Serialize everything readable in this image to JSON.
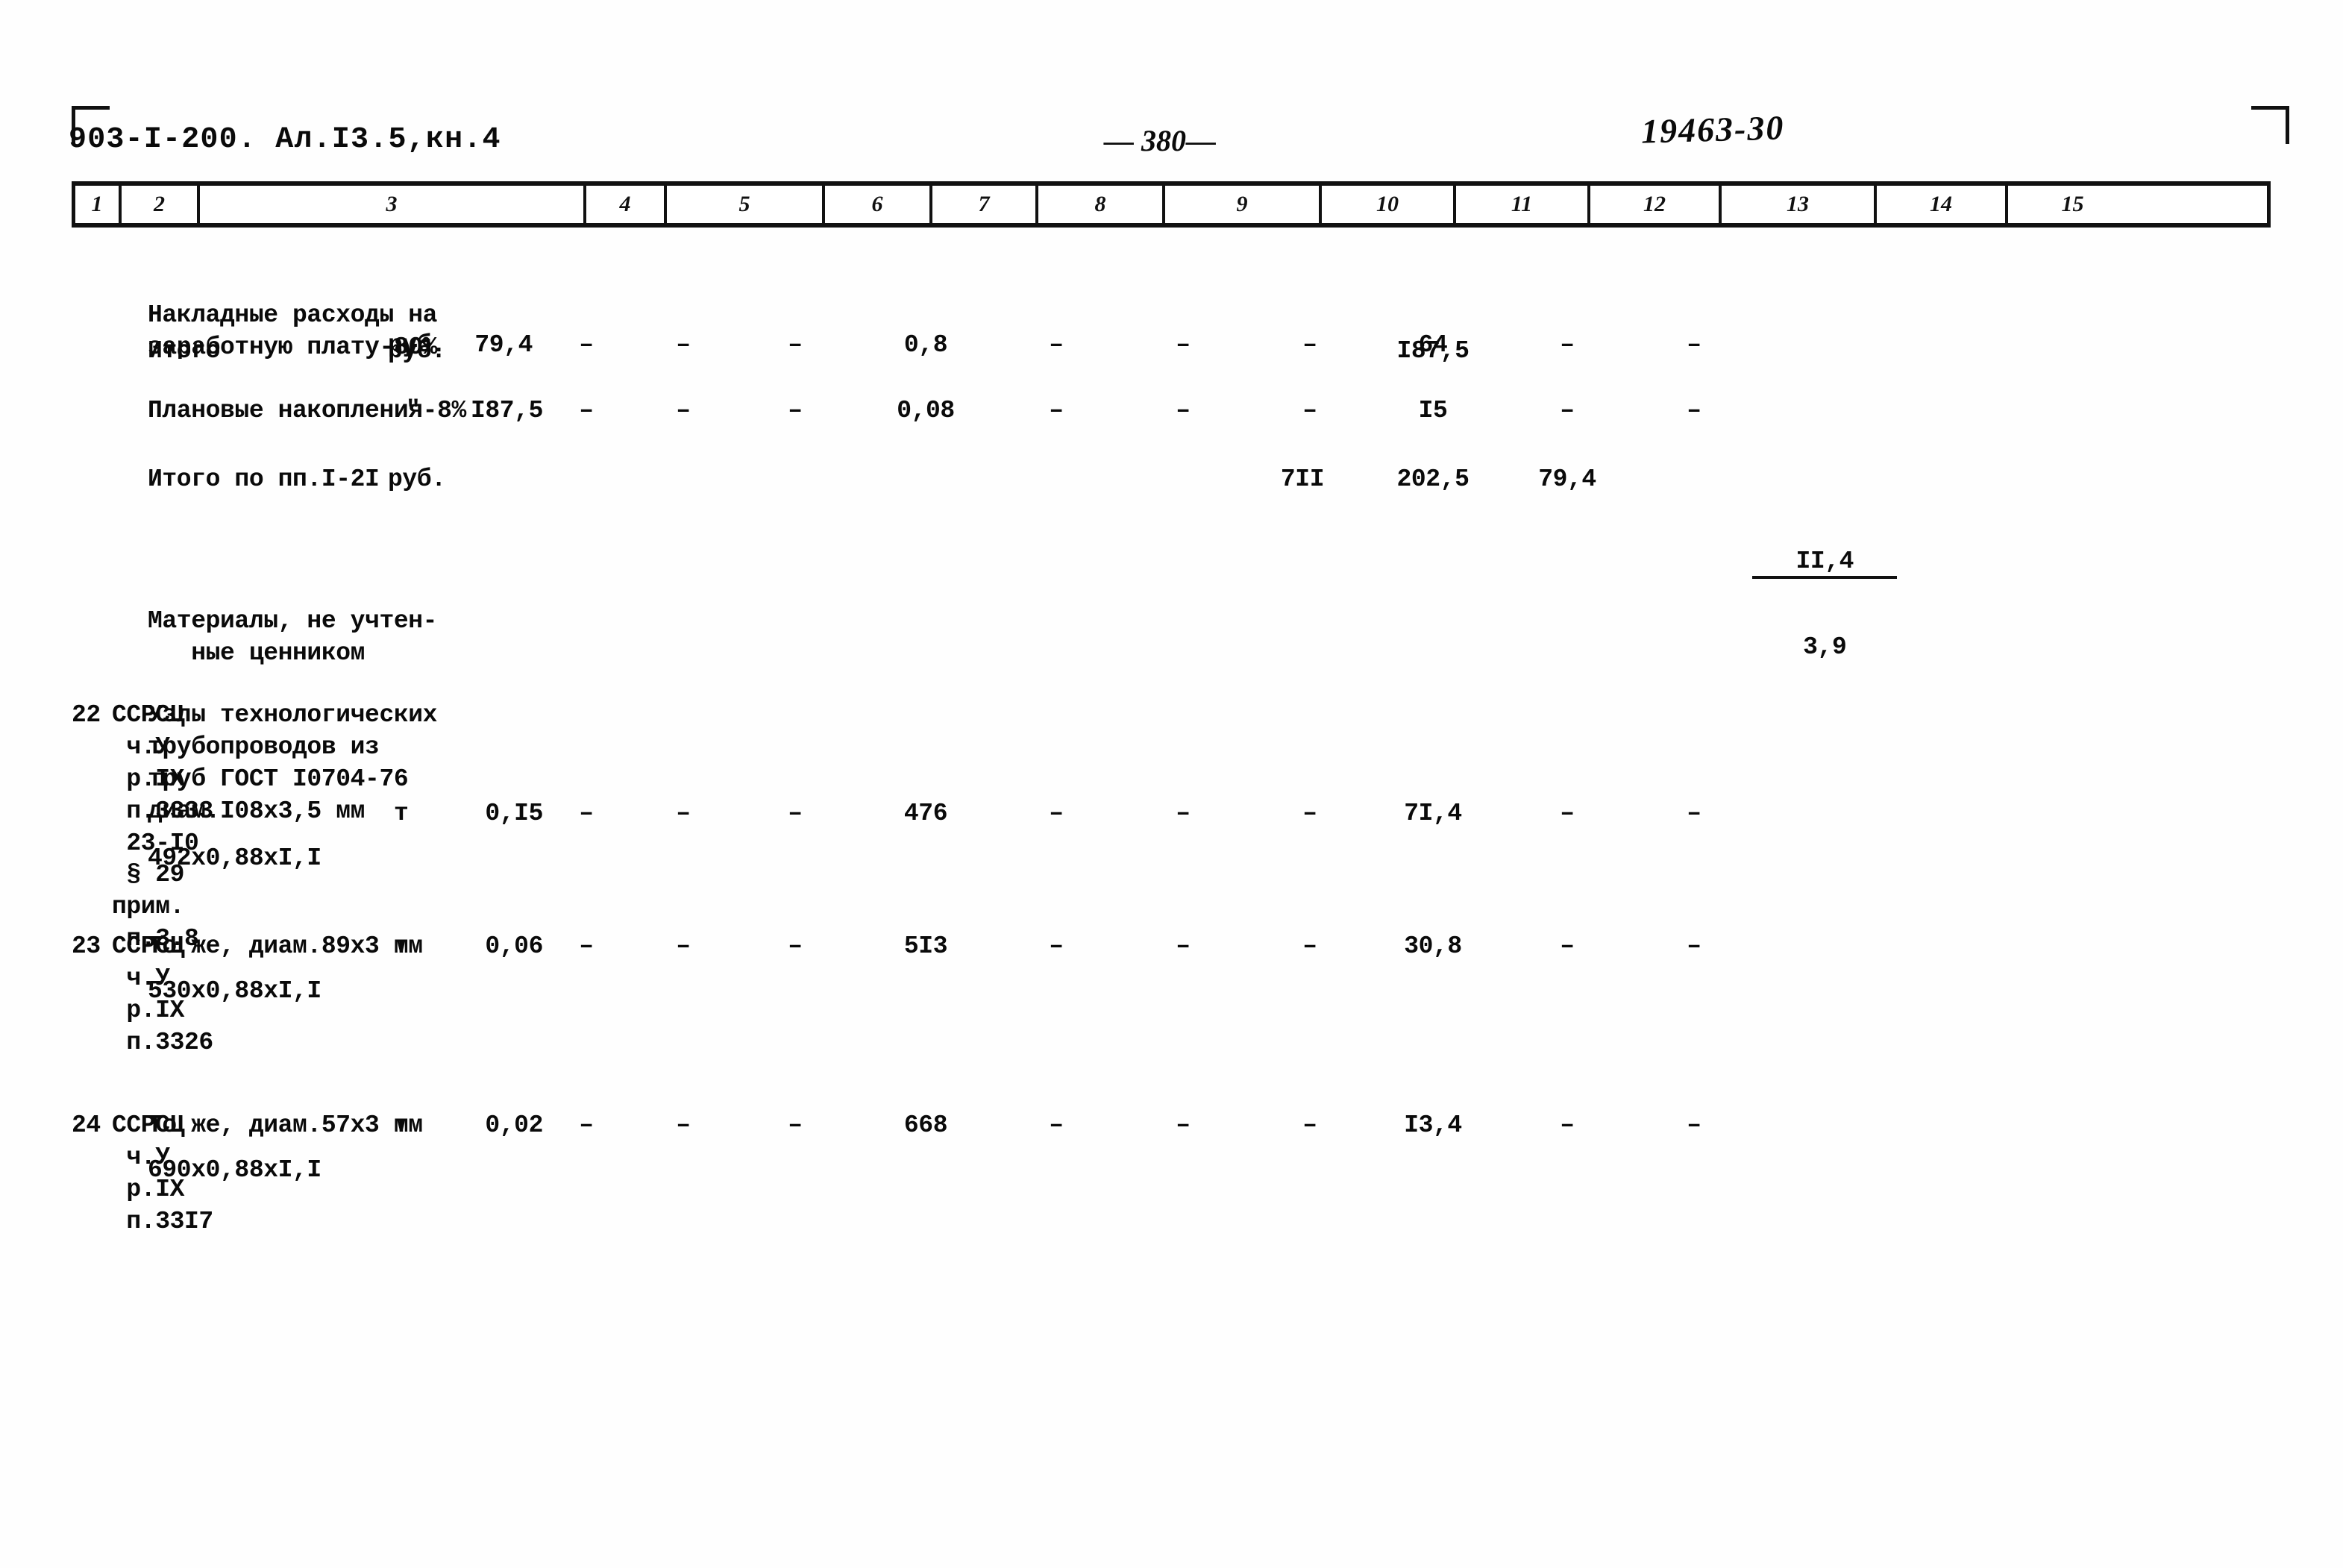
{
  "header": {
    "doc_code": "903-I-200. Ал.I3.5,кн.4",
    "page_number": "— 380—",
    "stamp": "19463-30"
  },
  "table": {
    "column_numbers": [
      "1",
      "2",
      "3",
      "4",
      "5",
      "6",
      "7",
      "8",
      "9",
      "10",
      "11",
      "12",
      "13",
      "14",
      "15"
    ],
    "rows": [
      {
        "id": "overhead",
        "pos": "",
        "code": "",
        "description": "Накладные расходы на\nзаработную плату-80%",
        "unit": "руб.",
        "c5": "79,4",
        "c6": "–",
        "c7": "–",
        "c8": "–",
        "c9": "0,8",
        "c10": "–",
        "c11": "–",
        "c12": "–",
        "c13": "64",
        "c14": "–",
        "c15": "–"
      },
      {
        "id": "subtotal",
        "pos": "",
        "code": "",
        "description": "Итого",
        "unit": "руб.",
        "c5": "",
        "c6": "",
        "c7": "",
        "c8": "",
        "c9": "",
        "c10": "",
        "c11": "",
        "c12": "",
        "c13": "I87,5",
        "c14": "",
        "c15": ""
      },
      {
        "id": "planned-savings",
        "pos": "",
        "code": "",
        "description": "Плановые накопления-8%",
        "unit": "\"",
        "c5": "I87,5",
        "c6": "–",
        "c7": "–",
        "c8": "–",
        "c9": "0,08",
        "c10": "–",
        "c11": "–",
        "c12": "–",
        "c13": "I5",
        "c14": "–",
        "c15": "–"
      },
      {
        "id": "total-items-1-21",
        "pos": "",
        "code": "",
        "description": "Итого по пп.I-2I",
        "unit": "руб.",
        "c5": "",
        "c6": "",
        "c7": "",
        "c8": "",
        "c9": "",
        "c10": "",
        "c11": "",
        "c12": "7II",
        "c13": "202,5",
        "c14": "79,4",
        "c15_fraction": {
          "numerator": "II,4",
          "denominator": "3,9"
        }
      },
      {
        "id": "materials-heading",
        "pos": "",
        "code": "",
        "description": "Материалы, не учтен-\n   ные ценником",
        "unit": "",
        "c5": "",
        "c6": "",
        "c7": "",
        "c8": "",
        "c9": "",
        "c10": "",
        "c11": "",
        "c12": "",
        "c13": "",
        "c14": "",
        "c15": ""
      },
      {
        "id": "item-22",
        "pos": "22",
        "code": "ССРСЦ\n ч.У\n р.IX\n п.3333\n 23-I0\n § 29\nприм.\n п.3.8",
        "description": "Узлы технологических\nтрубопроводов из\nтруб ГОСТ I0704-76\nдиам.I08x3,5 мм",
        "formula": "492x0,88xI,I",
        "unit": "т",
        "c5": "0,I5",
        "c6": "–",
        "c7": "–",
        "c8": "–",
        "c9": "476",
        "c10": "–",
        "c11": "–",
        "c12": "–",
        "c13": "7I,4",
        "c14": "–",
        "c15": "–"
      },
      {
        "id": "item-23",
        "pos": "23",
        "code": "ССРСЦ\n ч.У\n р.IX\n п.3326",
        "description": "То же, диам.89x3 мм",
        "formula": "530x0,88xI,I",
        "unit": "т",
        "c5": "0,06",
        "c6": "–",
        "c7": "–",
        "c8": "–",
        "c9": "5I3",
        "c10": "–",
        "c11": "–",
        "c12": "–",
        "c13": "30,8",
        "c14": "–",
        "c15": "–"
      },
      {
        "id": "item-24",
        "pos": "24",
        "code": "ССРСЦ\n ч.У\n р.IX\n п.33I7",
        "description": "То же, диам.57x3 мм",
        "formula": "690x0,88xI,I",
        "unit": "т",
        "c5": "0,02",
        "c6": "–",
        "c7": "–",
        "c8": "–",
        "c9": "668",
        "c10": "–",
        "c11": "–",
        "c12": "–",
        "c13": "I3,4",
        "c14": "–",
        "c15": "–"
      }
    ]
  }
}
